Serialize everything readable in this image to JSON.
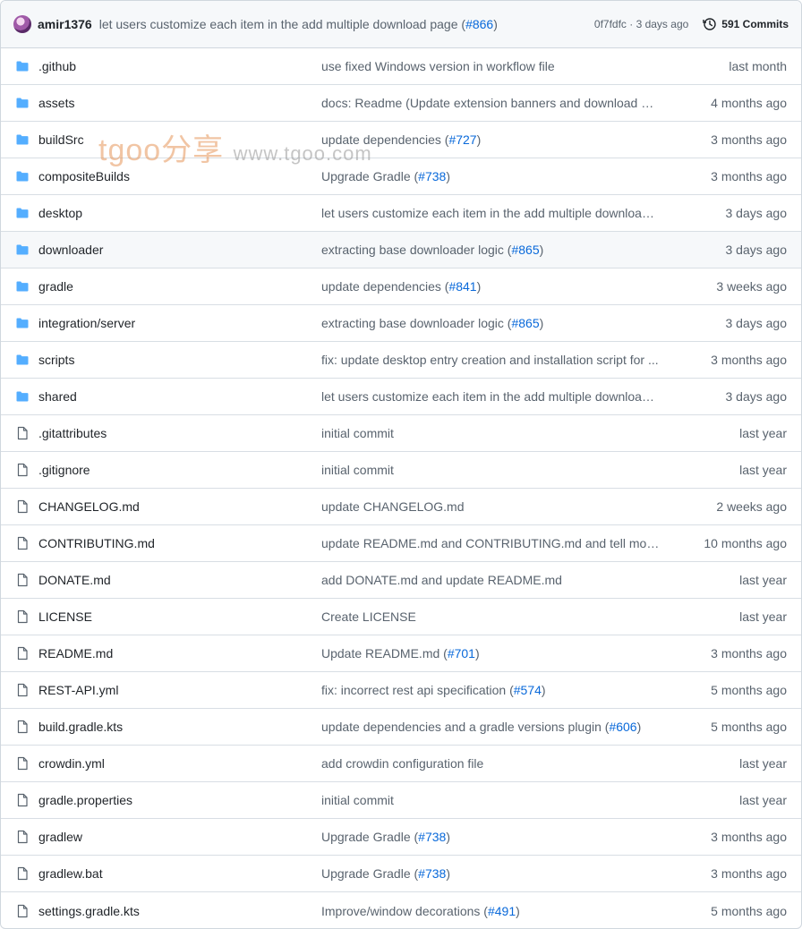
{
  "header": {
    "author": "amir1376",
    "message_text": "let users customize each item in the add multiple download page (",
    "message_link": "#866",
    "message_tail": ")",
    "sha_time": "0f7fdfc · 3 days ago",
    "commits_label": "591 Commits"
  },
  "watermark": {
    "big": "tgoo分享",
    "small": "www.tgoo.com"
  },
  "files": [
    {
      "type": "folder",
      "name": ".github",
      "msg": "use fixed Windows version in workflow file",
      "link": "",
      "tail": "",
      "age": "last month"
    },
    {
      "type": "folder",
      "name": "assets",
      "msg": "docs: Readme (Update extension banners and download ba...",
      "link": "",
      "tail": "",
      "age": "4 months ago"
    },
    {
      "type": "folder",
      "name": "buildSrc",
      "msg": "update dependencies (",
      "link": "#727",
      "tail": ")",
      "age": "3 months ago"
    },
    {
      "type": "folder",
      "name": "compositeBuilds",
      "msg": "Upgrade Gradle (",
      "link": "#738",
      "tail": ")",
      "age": "3 months ago"
    },
    {
      "type": "folder",
      "name": "desktop",
      "msg": "let users customize each item in the add multiple download ...",
      "link": "",
      "tail": "",
      "age": "3 days ago"
    },
    {
      "type": "folder",
      "name": "downloader",
      "msg": "extracting base downloader logic (",
      "link": "#865",
      "tail": ")",
      "age": "3 days ago"
    },
    {
      "type": "folder",
      "name": "gradle",
      "msg": "update dependencies (",
      "link": "#841",
      "tail": ")",
      "age": "3 weeks ago"
    },
    {
      "type": "folder",
      "name": "integration/server",
      "msg": "extracting base downloader logic (",
      "link": "#865",
      "tail": ")",
      "age": "3 days ago"
    },
    {
      "type": "folder",
      "name": "scripts",
      "msg": "fix: update desktop entry creation and installation script for ...",
      "link": "",
      "tail": "",
      "age": "3 months ago"
    },
    {
      "type": "folder",
      "name": "shared",
      "msg": "let users customize each item in the add multiple download ...",
      "link": "",
      "tail": "",
      "age": "3 days ago"
    },
    {
      "type": "file",
      "name": ".gitattributes",
      "msg": "initial commit",
      "link": "",
      "tail": "",
      "age": "last year"
    },
    {
      "type": "file",
      "name": ".gitignore",
      "msg": "initial commit",
      "link": "",
      "tail": "",
      "age": "last year"
    },
    {
      "type": "file",
      "name": "CHANGELOG.md",
      "msg": "update CHANGELOG.md",
      "link": "",
      "tail": "",
      "age": "2 weeks ago"
    },
    {
      "type": "file",
      "name": "CONTRIBUTING.md",
      "msg": "update README.md and CONTRIBUTING.md and tell more a...",
      "link": "",
      "tail": "",
      "age": "10 months ago"
    },
    {
      "type": "file",
      "name": "DONATE.md",
      "msg": "add DONATE.md and update README.md",
      "link": "",
      "tail": "",
      "age": "last year"
    },
    {
      "type": "file",
      "name": "LICENSE",
      "msg": "Create LICENSE",
      "link": "",
      "tail": "",
      "age": "last year"
    },
    {
      "type": "file",
      "name": "README.md",
      "msg": "Update README.md (",
      "link": "#701",
      "tail": ")",
      "age": "3 months ago"
    },
    {
      "type": "file",
      "name": "REST-API.yml",
      "msg": "fix: incorrect rest api specification (",
      "link": "#574",
      "tail": ")",
      "age": "5 months ago"
    },
    {
      "type": "file",
      "name": "build.gradle.kts",
      "msg": "update dependencies and a gradle versions plugin (",
      "link": "#606",
      "tail": ")",
      "age": "5 months ago"
    },
    {
      "type": "file",
      "name": "crowdin.yml",
      "msg": "add crowdin configuration file",
      "link": "",
      "tail": "",
      "age": "last year"
    },
    {
      "type": "file",
      "name": "gradle.properties",
      "msg": "initial commit",
      "link": "",
      "tail": "",
      "age": "last year"
    },
    {
      "type": "file",
      "name": "gradlew",
      "msg": "Upgrade Gradle (",
      "link": "#738",
      "tail": ")",
      "age": "3 months ago"
    },
    {
      "type": "file",
      "name": "gradlew.bat",
      "msg": "Upgrade Gradle (",
      "link": "#738",
      "tail": ")",
      "age": "3 months ago"
    },
    {
      "type": "file",
      "name": "settings.gradle.kts",
      "msg": "Improve/window decorations (",
      "link": "#491",
      "tail": ")",
      "age": "5 months ago"
    }
  ],
  "highlighted_row": "downloader",
  "colors": {
    "folder": "#54aeff",
    "link": "#0969da",
    "muted": "#59636e",
    "border": "#d0d7de"
  }
}
